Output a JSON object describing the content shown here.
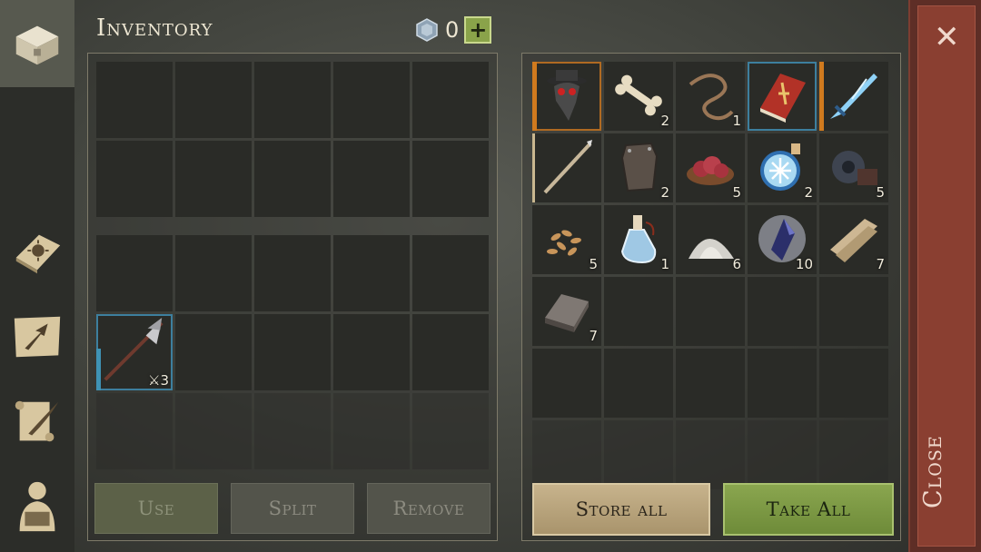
{
  "header": {
    "title": "Inventory",
    "gem_count": "0",
    "add_label": "+"
  },
  "sidebar": {
    "items": [
      {
        "name": "chest-icon"
      },
      {
        "name": "sun-book-icon"
      },
      {
        "name": "map-arrow-icon"
      },
      {
        "name": "scroll-quill-icon"
      },
      {
        "name": "character-backpack-icon"
      }
    ]
  },
  "player_inventory": {
    "equipped_item": {
      "name": "halberd-icon",
      "qty": "3",
      "durability_fraction": 0.55
    }
  },
  "buttons": {
    "use": "Use",
    "split": "Split",
    "remove": "Remove",
    "store_all": "Store all",
    "take_all": "Take All",
    "close": "Close"
  },
  "storage": {
    "items": [
      {
        "icon": "plague-mask-icon",
        "qty": ""
      },
      {
        "icon": "bone-icon",
        "qty": "2"
      },
      {
        "icon": "rope-icon",
        "qty": "1"
      },
      {
        "icon": "red-book-icon",
        "qty": ""
      },
      {
        "icon": "ice-sword-icon",
        "qty": ""
      },
      {
        "icon": "spear-icon",
        "qty": ""
      },
      {
        "icon": "leather-plate-icon",
        "qty": "2"
      },
      {
        "icon": "meat-bowl-icon",
        "qty": "5"
      },
      {
        "icon": "frost-potion-icon",
        "qty": "2"
      },
      {
        "icon": "gear-parts-icon",
        "qty": "5"
      },
      {
        "icon": "seeds-icon",
        "qty": "5"
      },
      {
        "icon": "water-bottle-icon",
        "qty": "1"
      },
      {
        "icon": "salt-pile-icon",
        "qty": "6"
      },
      {
        "icon": "dark-crystal-icon",
        "qty": "10"
      },
      {
        "icon": "planks-icon",
        "qty": "7"
      },
      {
        "icon": "iron-ingot-icon",
        "qty": "7"
      }
    ]
  }
}
